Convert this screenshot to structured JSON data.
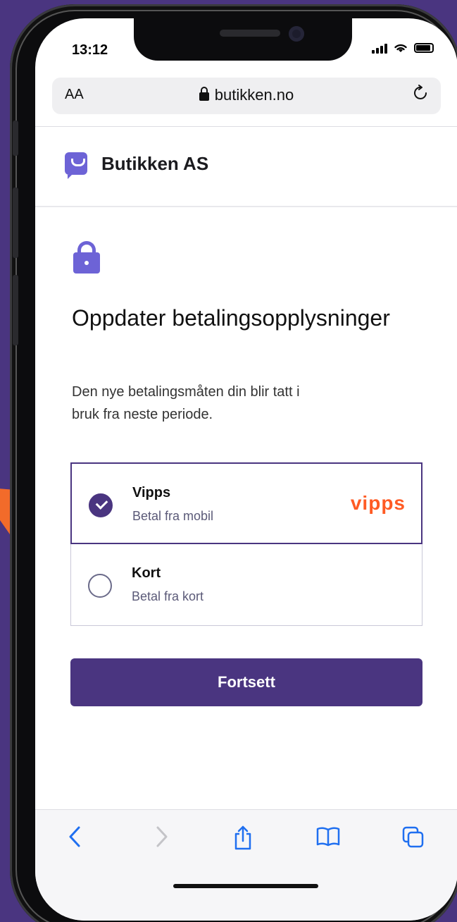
{
  "status_bar": {
    "time": "13:12"
  },
  "browser": {
    "text_size_label": "AA",
    "url": "butikken.no",
    "reload_icon": "reload-icon"
  },
  "site": {
    "name": "Butikken AS"
  },
  "page": {
    "title": "Oppdater betalingsopplysninger",
    "description": "Den nye betalingsmåten din blir tatt i bruk fra neste periode."
  },
  "payment_options": [
    {
      "label": "Vipps",
      "sublabel": "Betal fra mobil",
      "selected": true,
      "logo_text": "vipps"
    },
    {
      "label": "Kort",
      "sublabel": "Betal fra kort",
      "selected": false
    }
  ],
  "continue_label": "Fortsett",
  "toolbar": {
    "icons": [
      "back-icon",
      "forward-icon",
      "share-icon",
      "bookmarks-icon",
      "tabs-icon"
    ]
  },
  "colors": {
    "brand": "#4a3580",
    "accent": "#6d63d6",
    "vipps": "#ff5b24",
    "annotation_arrow": "#f26b2a"
  }
}
